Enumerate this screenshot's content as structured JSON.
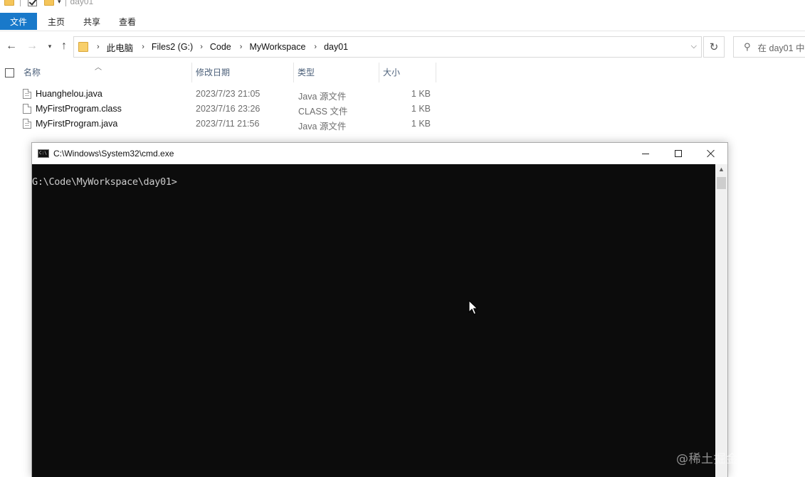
{
  "window": {
    "title": "day01"
  },
  "ribbon": {
    "tabs": [
      "文件",
      "主页",
      "共享",
      "查看"
    ]
  },
  "address": {
    "breadcrumbs": [
      "此电脑",
      "Files2 (G:)",
      "Code",
      "MyWorkspace",
      "day01"
    ]
  },
  "search": {
    "placeholder": "在 day01 中"
  },
  "columns": {
    "name": "名称",
    "date": "修改日期",
    "type": "类型",
    "size": "大小"
  },
  "files": [
    {
      "name": "Huanghelou.java",
      "date": "2023/7/23 21:05",
      "type": "Java 源文件",
      "size": "1 KB"
    },
    {
      "name": "MyFirstProgram.class",
      "date": "2023/7/16 23:26",
      "type": "CLASS 文件",
      "size": "1 KB"
    },
    {
      "name": "MyFirstProgram.java",
      "date": "2023/7/11 21:56",
      "type": "Java 源文件",
      "size": "1 KB"
    }
  ],
  "cmd": {
    "title": "C:\\Windows\\System32\\cmd.exe",
    "icon_text": "C:\\",
    "prompt": "G:\\Code\\MyWorkspace\\day01>"
  },
  "watermark": "@稀土掘金技术社区"
}
